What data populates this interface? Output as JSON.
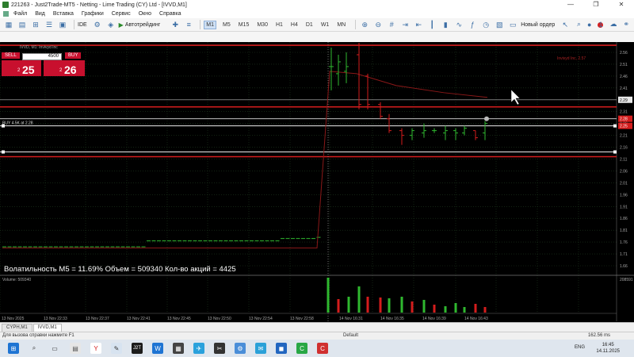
{
  "window": {
    "title": "221263 - Just2Trade-MT5 - Netting - Lime Trading (CY) Ltd - [IVVD,M1]",
    "controls": [
      "—",
      "❐",
      "✕"
    ]
  },
  "menu": [
    "Файл",
    "Вид",
    "Вставка",
    "Графики",
    "Сервис",
    "Окно",
    "Справка"
  ],
  "toolbar": {
    "algo_label": "Автотрейдинг",
    "new_order_label": "Новый ордер",
    "timeframes": [
      "M1",
      "M5",
      "M15",
      "M30",
      "H1",
      "H4",
      "D1",
      "W1",
      "MN"
    ],
    "active_timeframe": "M1",
    "notification_count": "1",
    "ide_label": "IDE"
  },
  "trade_panel": {
    "sell_label": "SELL",
    "buy_label": "BUY",
    "quantity": "4500",
    "sell_prefix": "2",
    "sell_big": "25",
    "buy_prefix": "2",
    "buy_big": "26"
  },
  "chart": {
    "symbol_label": "IVVD, M1: Invivyd Inc",
    "buy_label": "BUY 4.5K at 2.28",
    "volatility_text": "Волатильность М5 = 11.69% Объем = 509340 Кол-во акций = 4425",
    "volume_label": "Volume: 509340",
    "volume_max_label": "208591",
    "red_annotation": "Invivyd Inc, 2.57",
    "y_ticks": [
      "2.56",
      "2.51",
      "2.46",
      "2.41",
      "2.36",
      "2.31",
      "2.26",
      "2.21",
      "2.16",
      "2.11",
      "2.06",
      "2.01",
      "1.96",
      "1.91",
      "1.86",
      "1.81",
      "1.76",
      "1.71",
      "1.66"
    ],
    "x_ticks": [
      "13 Nov 2025",
      "13 Nov 22:33",
      "13 Nov 22:37",
      "13 Nov 22:41",
      "13 Nov 22:45",
      "13 Nov 22:50",
      "13 Nov 22:54",
      "13 Nov 22:58",
      "14 Nov 16:31",
      "14 Nov 16:35",
      "14 Nov 16:39",
      "14 Nov 16:43"
    ],
    "price_tags": [
      "2.29",
      "2.28",
      "2.25"
    ]
  },
  "tabs": [
    "CYPH,M1",
    "IVVD,M1"
  ],
  "active_tab": "IVVD,M1",
  "status": {
    "help": "Для вызова справки нажмите F1",
    "profile": "Default",
    "traffic": "162.56 ms"
  },
  "taskbar": {
    "lang": "ENG",
    "time": "16:45",
    "date": "14.11.2025"
  }
}
